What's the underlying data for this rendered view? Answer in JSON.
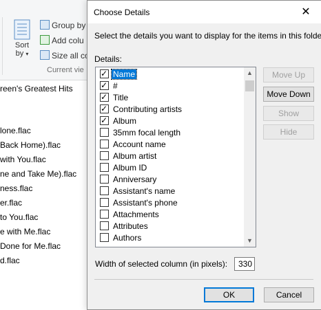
{
  "explorer": {
    "ribbon": {
      "sort_label": "Sort",
      "sort_by_label": "by",
      "group_by_label": "Group by",
      "add_columns_label": "Add colu",
      "size_all_label": "Size all co",
      "current_view_label": "Current vie"
    },
    "folder_title": "reen's Greatest Hits",
    "files": [
      "lone.flac",
      "Back Home).flac",
      "with You.flac",
      "ne and Take Me).flac",
      "ness.flac",
      "er.flac",
      "to You.flac",
      "e with Me.flac",
      "Done for Me.flac",
      "d.flac"
    ]
  },
  "dialog": {
    "title": "Choose Details",
    "close_glyph": "✕",
    "instructions": "Select the details you want to display for the items in this folder.",
    "details_label": "Details:",
    "items": [
      {
        "label": "Name",
        "checked": true,
        "selected": true
      },
      {
        "label": "#",
        "checked": true,
        "selected": false
      },
      {
        "label": "Title",
        "checked": true,
        "selected": false
      },
      {
        "label": "Contributing artists",
        "checked": true,
        "selected": false
      },
      {
        "label": "Album",
        "checked": true,
        "selected": false
      },
      {
        "label": "35mm focal length",
        "checked": false,
        "selected": false
      },
      {
        "label": "Account name",
        "checked": false,
        "selected": false
      },
      {
        "label": "Album artist",
        "checked": false,
        "selected": false
      },
      {
        "label": "Album ID",
        "checked": false,
        "selected": false
      },
      {
        "label": "Anniversary",
        "checked": false,
        "selected": false
      },
      {
        "label": "Assistant's name",
        "checked": false,
        "selected": false
      },
      {
        "label": "Assistant's phone",
        "checked": false,
        "selected": false
      },
      {
        "label": "Attachments",
        "checked": false,
        "selected": false
      },
      {
        "label": "Attributes",
        "checked": false,
        "selected": false
      },
      {
        "label": "Authors",
        "checked": false,
        "selected": false
      }
    ],
    "buttons": {
      "move_up": "Move Up",
      "move_down": "Move Down",
      "show": "Show",
      "hide": "Hide",
      "ok": "OK",
      "cancel": "Cancel"
    },
    "width_label": "Width of selected column (in pixels):",
    "width_value": "330",
    "colors": {
      "selection": "#0078d7",
      "dialog_bg": "#f0f0f0"
    }
  }
}
